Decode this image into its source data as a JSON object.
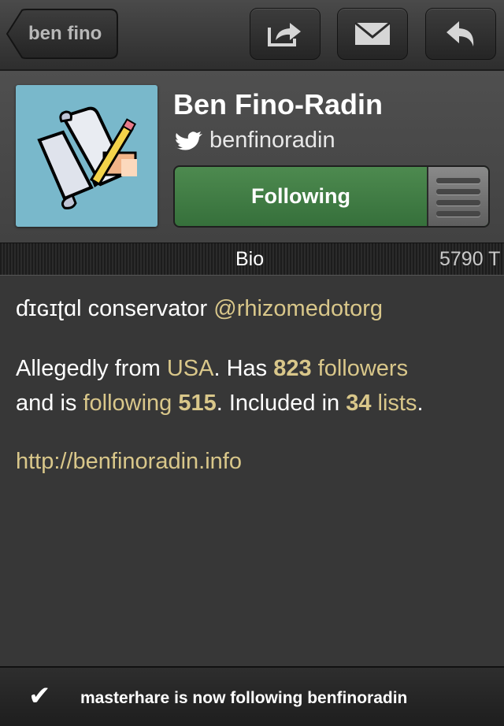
{
  "navbar": {
    "back_label": "ben fino",
    "icons": [
      "share-icon",
      "mail-icon",
      "reply-icon"
    ]
  },
  "profile": {
    "name": "Ben Fino-Radin",
    "handle": "benfinoradin",
    "follow_label": "Following",
    "avatar": "scroll-and-pencil-pixel-icon"
  },
  "tabs": {
    "bio": "Bio",
    "count": "5790 T"
  },
  "bio": {
    "tagline": "ɗɪɢɪʈɑl conservator",
    "tagline_link": "@rhizomedotorg",
    "from_prefix": "Allegedly from",
    "location": "USA",
    "has": ". Has",
    "followers_count": "823",
    "followers_word": "followers",
    "and_is": "and is",
    "following_word": "following",
    "following_count": "515",
    "included": ". Included in",
    "lists_count": "34",
    "lists_word": "lists",
    "period": ".",
    "url": "http://benfinoradin.info"
  },
  "toast": {
    "message": "masterhare is now following benfinoradin"
  },
  "colors": {
    "link": "#d9c78a",
    "follow_green": "#3f7d44",
    "background": "#373737"
  }
}
